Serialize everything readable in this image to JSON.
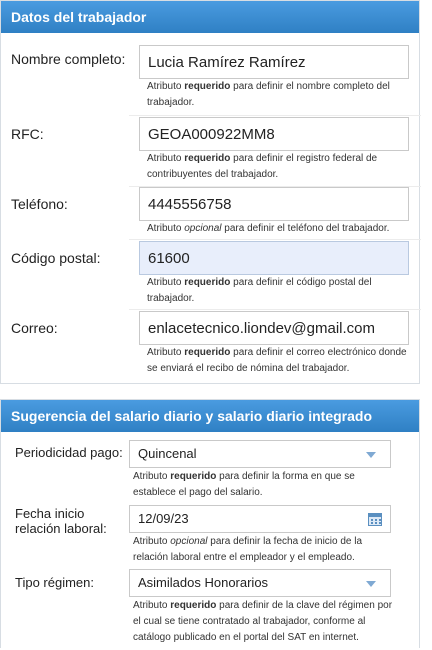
{
  "worker": {
    "header": "Datos del trabajador",
    "fields": [
      {
        "label": "Nombre completo:",
        "value": "Lucia Ramírez Ramírez",
        "help_pre": "Atributo ",
        "help_kw": "requerido",
        "help_post": " para definir el nombre completo del",
        "help_line2": "trabajador."
      },
      {
        "label": "RFC:",
        "value": "GEOA000922MM8",
        "help_pre": "Atributo ",
        "help_kw": "requerido",
        "help_post": " para definir el registro federal de",
        "help_line2": "contribuyentes del trabajador."
      },
      {
        "label": "Teléfono:",
        "value": "4445556758",
        "help_pre": "Atributo ",
        "help_kw": "opcional",
        "help_post": " para definir el teléfono del trabajador.",
        "help_line2": ""
      },
      {
        "label": "Código postal:",
        "value": "61600",
        "help_pre": "Atributo ",
        "help_kw": "requerido",
        "help_post": " para definir el código postal del",
        "help_line2": "trabajador."
      },
      {
        "label": "Correo:",
        "value": "enlacetecnico.liondev@gmail.com",
        "help_pre": "Atributo ",
        "help_kw": "requerido",
        "help_post": " para definir el correo electrónico donde",
        "help_line2": "se enviará el recibo de nómina del trabajador."
      }
    ]
  },
  "salary": {
    "header": "Sugerencia del salario diario y salario diario integrado",
    "periodicity": {
      "label": "Periodicidad pago:",
      "value": "Quincenal",
      "help_pre": "Atributo ",
      "help_kw": "requerido",
      "help_post": " para definir la forma en que se",
      "help_line2": "establece el pago del salario."
    },
    "start_date": {
      "label_line1": "Fecha inicio",
      "label_line2": "relación laboral:",
      "value": "12/09/23",
      "help_pre": "Atributo ",
      "help_kw": "opcional",
      "help_post": " para definir la fecha de inicio de la",
      "help_line2": "relación laboral entre el empleador y el empleado."
    },
    "regime": {
      "label": "Tipo régimen:",
      "value": "Asimilados Honorarios",
      "help_pre": "Atributo ",
      "help_kw": "requerido",
      "help_post": " para definir de la clave del régimen por",
      "help_line2": "el cual se tiene contratado al trabajador, conforme al",
      "help_line3": "catálogo publicado en el portal del SAT en internet."
    }
  }
}
